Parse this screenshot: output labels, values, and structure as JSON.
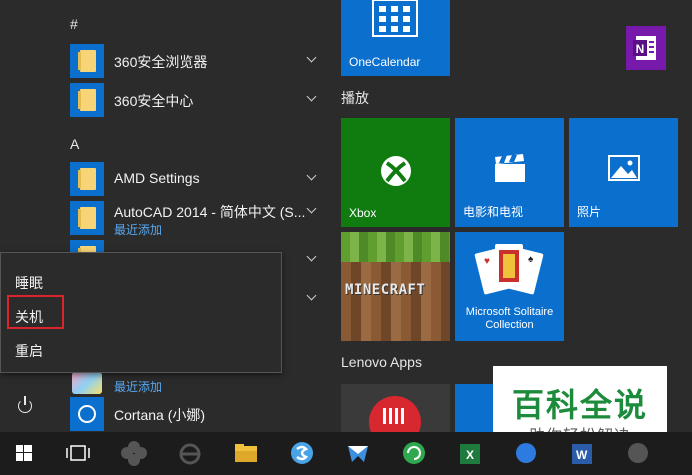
{
  "start_menu": {
    "groups": [
      {
        "letter": "#"
      },
      {
        "letter": "A"
      }
    ],
    "apps": [
      {
        "name": "360安全浏览器",
        "icon": "folder-icon",
        "expandable": true
      },
      {
        "name": "360安全中心",
        "icon": "folder-icon",
        "expandable": true
      },
      {
        "name": "AMD Settings",
        "icon": "folder-icon",
        "expandable": true
      },
      {
        "name": "AutoCAD 2014 - 简体中文 (S...",
        "sub": "最近添加",
        "icon": "folder-icon",
        "expandable": true
      },
      {
        "name": "",
        "sub": "最近添加",
        "icon": "app-icon"
      },
      {
        "name": "Cortana (小娜)",
        "icon": "cortana-icon"
      }
    ],
    "power_menu": {
      "items": [
        "睡眠",
        "关机",
        "重启"
      ],
      "highlighted": "关机"
    }
  },
  "tiles": {
    "sections": [
      "播放",
      "Lenovo Apps"
    ],
    "items": [
      {
        "label": "OneCalendar",
        "color": "#0b6fcd"
      },
      {
        "label": "",
        "icon": "onenote-icon",
        "color": "#7719aa"
      },
      {
        "label": "Xbox",
        "color": "#107c10"
      },
      {
        "label": "电影和电视",
        "color": "#0b6fcd"
      },
      {
        "label": "照片",
        "color": "#0b6fcd"
      },
      {
        "label": "",
        "icon": "minecraft-logo",
        "logo_text": "MINECRAFT"
      },
      {
        "label": "Microsoft Solitaire Collection",
        "color": "#0b6fcd"
      }
    ]
  },
  "taskbar": {
    "icons": [
      "windows-start-icon",
      "task-view-icon",
      "pinwheel-icon",
      "ie-icon",
      "file-explorer-icon",
      "sogou-icon",
      "mail-icon",
      "refresh-green-icon",
      "excel-icon",
      "word-icon",
      "globe-icon"
    ]
  },
  "watermark": {
    "title": "百科全说",
    "subtitle": "助你轻松解决"
  }
}
